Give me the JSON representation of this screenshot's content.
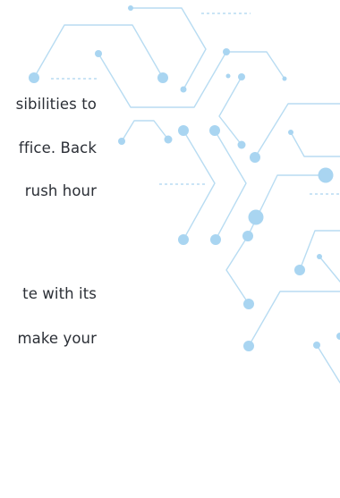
{
  "colors": {
    "background": "#ffffff",
    "text": "#2b2f36",
    "circuit_line": "#b8dcf2",
    "circuit_node": "#a9d5f1"
  },
  "paragraph1": {
    "line1": "sibilities to",
    "line2": "ffice. Back",
    "line3": "rush hour"
  },
  "paragraph2": {
    "line1": "te with its",
    "line2": "make your"
  },
  "decoration": {
    "graphic_name": "circuit-board-pattern"
  }
}
